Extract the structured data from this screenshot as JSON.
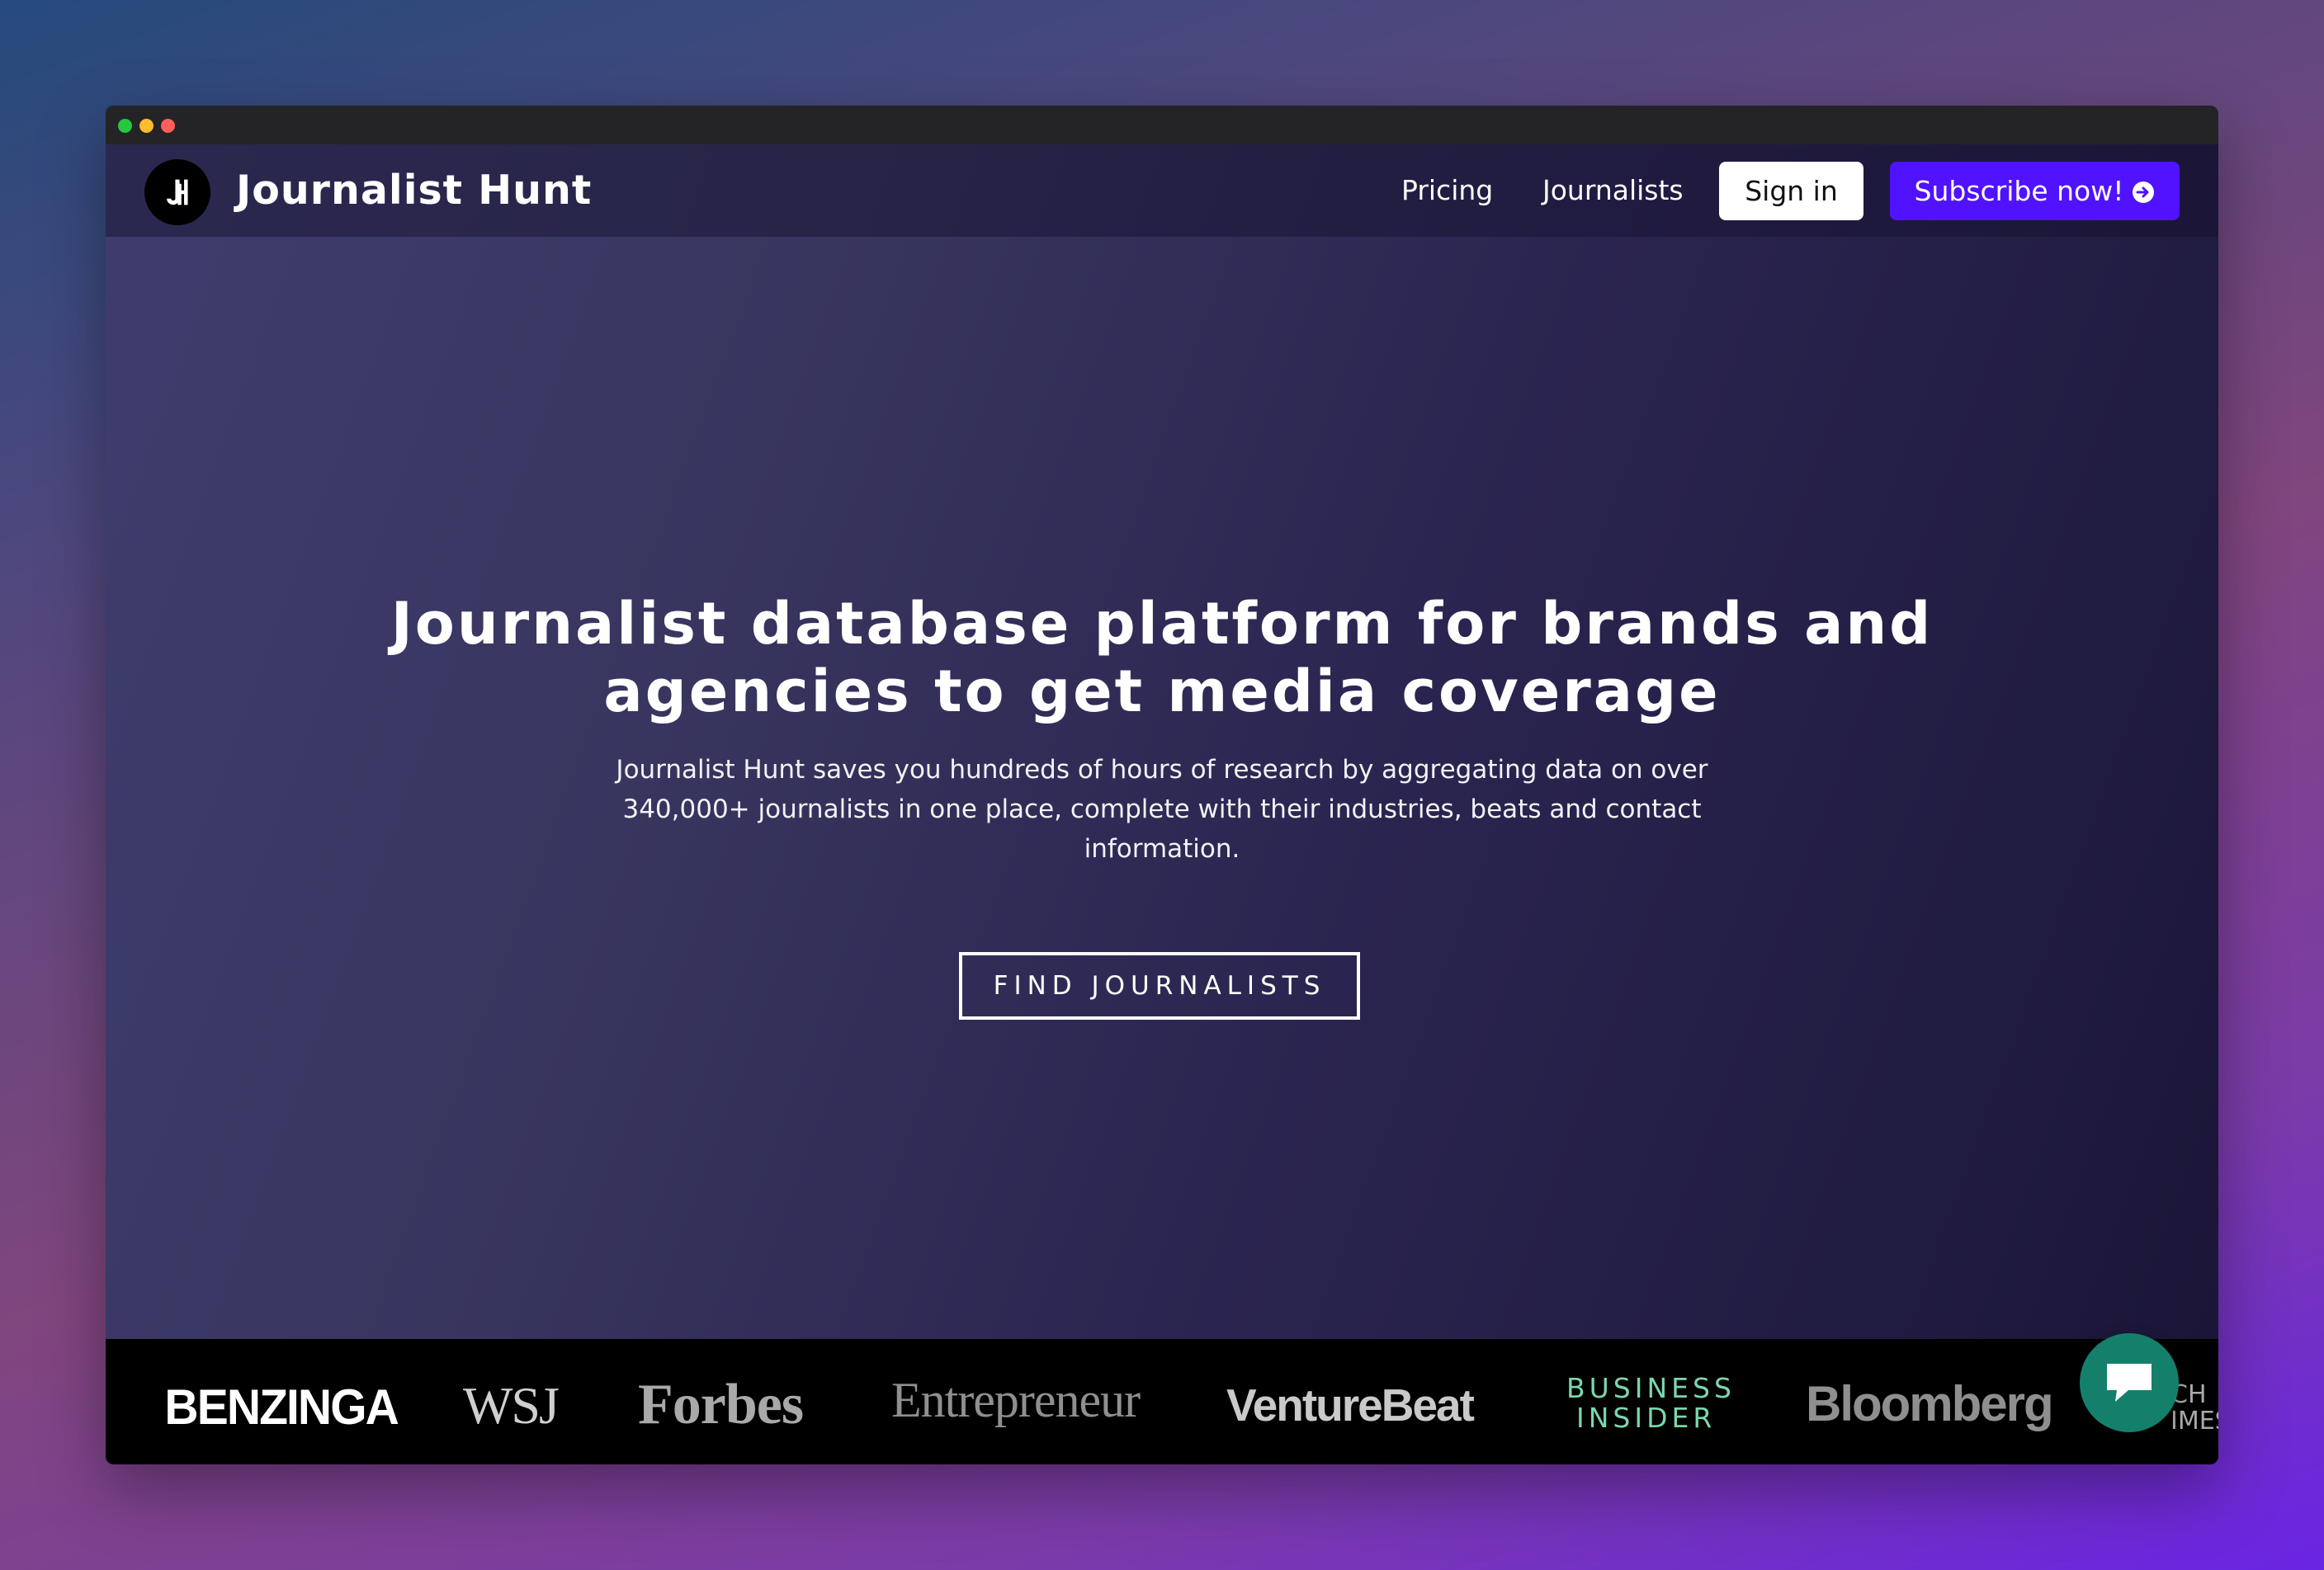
{
  "brand": {
    "name": "Journalist Hunt",
    "logo_icon": "jh-monogram-icon"
  },
  "nav": {
    "links": [
      {
        "label": "Pricing"
      },
      {
        "label": "Journalists"
      }
    ],
    "sign_in": "Sign in",
    "subscribe": "Subscribe now!",
    "subscribe_icon": "arrow-right-circle-icon"
  },
  "hero": {
    "headline_line1": "Journalist database platform for brands and",
    "headline_line2": "agencies to get media coverage",
    "subtext_line1": "Journalist Hunt saves you hundreds of hours of research by aggregating data on over",
    "subtext_line2": "340,000+ journalists in one place, complete with their industries, beats and contact",
    "subtext_line3": "information.",
    "cta": "FIND JOURNALISTS"
  },
  "press_logos": {
    "benzinga": "BENZINGA",
    "wsj": "WSJ",
    "forbes": "Forbes",
    "entrepreneur": "Entrepreneur",
    "venturebeat": "VentureBeat",
    "business_insider_line1": "BUSINESS",
    "business_insider_line2": "INSIDER",
    "bloomberg": "Bloomberg",
    "tech_times_line1": "CH",
    "tech_times_line2": "IMES"
  },
  "chat": {
    "icon": "chat-bubble-icon"
  },
  "colors": {
    "subscribe_bg": "#5012ff",
    "chat_bg": "#14806b",
    "business_insider": "#7ad7ad"
  }
}
